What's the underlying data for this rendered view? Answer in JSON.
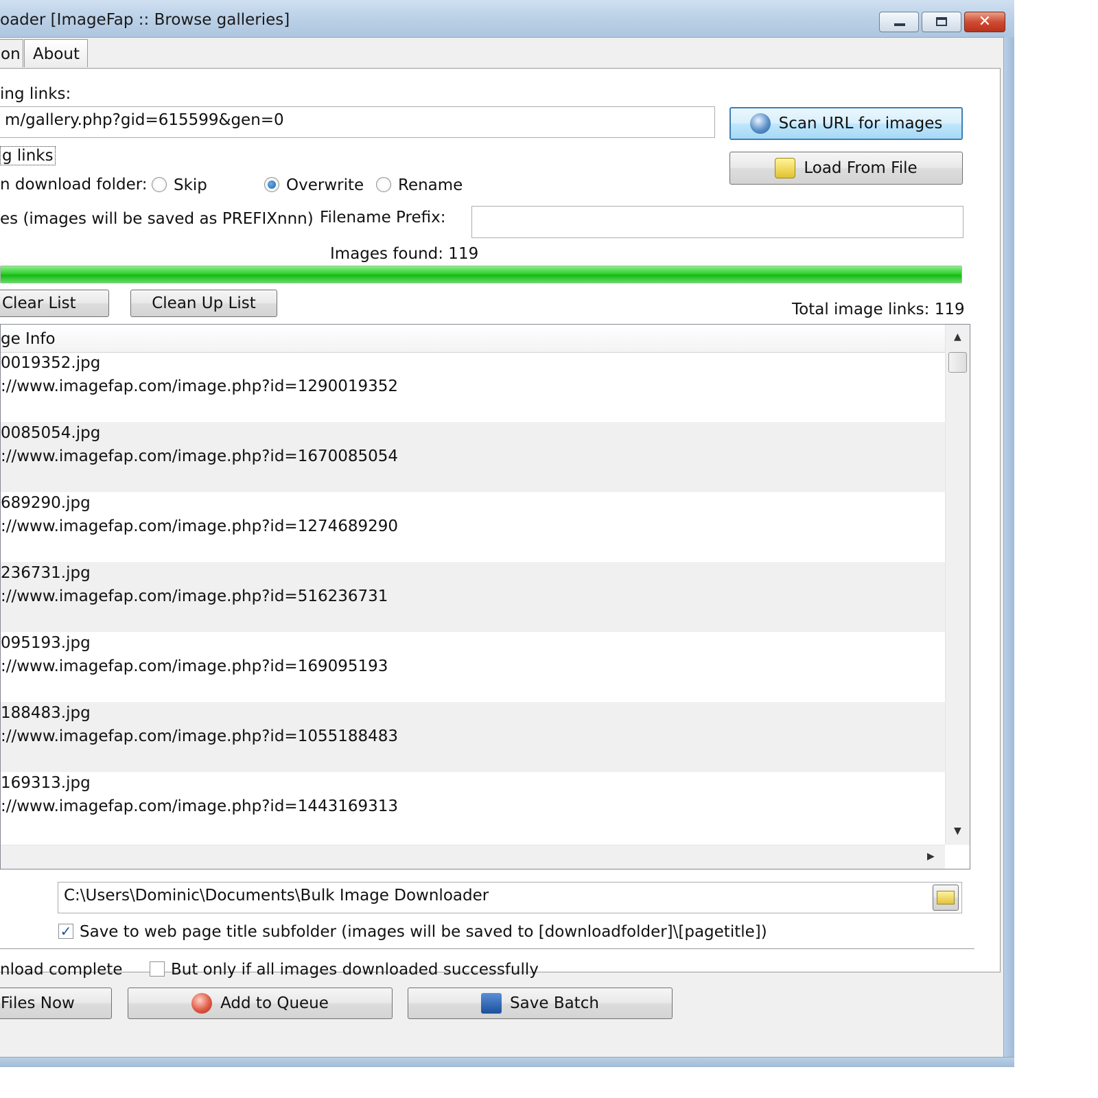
{
  "window": {
    "title": "oader [ImageFap :: Browse galleries]",
    "controls": {
      "minimize": "minimize",
      "maximize": "maximize",
      "close": "close"
    }
  },
  "tabs": [
    {
      "label": "on"
    },
    {
      "label": "About"
    }
  ],
  "form": {
    "links_label": "ing links:",
    "url_value": "m/gallery.php?gid=615599&gen=0",
    "scan_button": "Scan URL for images",
    "load_button": "Load From File",
    "links_checkbox_label": "g links",
    "existing_label": "n download folder:",
    "radio_options": [
      {
        "label": "Skip",
        "selected": false
      },
      {
        "label": "Overwrite",
        "selected": true
      },
      {
        "label": "Rename",
        "selected": false
      }
    ],
    "prefix_desc": "es (images will be saved as PREFIXnnn)",
    "prefix_label": "Filename Prefix:",
    "prefix_value": "",
    "images_found": "Images found: 119",
    "progress": 1.0
  },
  "list": {
    "clear_button": "Clear List",
    "cleanup_button": "Clean Up List",
    "total_links": "Total image links: 119",
    "header": "ge Info",
    "rows": [
      {
        "file": "0019352.jpg",
        "url": "://www.imagefap.com/image.php?id=1290019352"
      },
      {
        "file": "0085054.jpg",
        "url": "://www.imagefap.com/image.php?id=1670085054"
      },
      {
        "file": "689290.jpg",
        "url": "://www.imagefap.com/image.php?id=1274689290"
      },
      {
        "file": "236731.jpg",
        "url": "://www.imagefap.com/image.php?id=516236731"
      },
      {
        "file": "095193.jpg",
        "url": "://www.imagefap.com/image.php?id=169095193"
      },
      {
        "file": "188483.jpg",
        "url": "://www.imagefap.com/image.php?id=1055188483"
      },
      {
        "file": "169313.jpg",
        "url": "://www.imagefap.com/image.php?id=1443169313"
      }
    ]
  },
  "download": {
    "folder": "C:\\Users\\Dominic\\Documents\\Bulk Image Downloader",
    "subfolder_checked": true,
    "subfolder_label": "Save to web page title subfolder (images will be saved to [downloadfolder]\\[pagetitle])",
    "complete_label": "nload complete",
    "only_success_checked": false,
    "only_success_label": "But only if all images downloaded successfully",
    "files_now_button": "Files Now",
    "queue_button": "Add to Queue",
    "save_batch_button": "Save Batch"
  },
  "colors": {
    "progress": "#2fcf2f",
    "accent": "#3c7fb1",
    "close": "#cf4b32"
  }
}
